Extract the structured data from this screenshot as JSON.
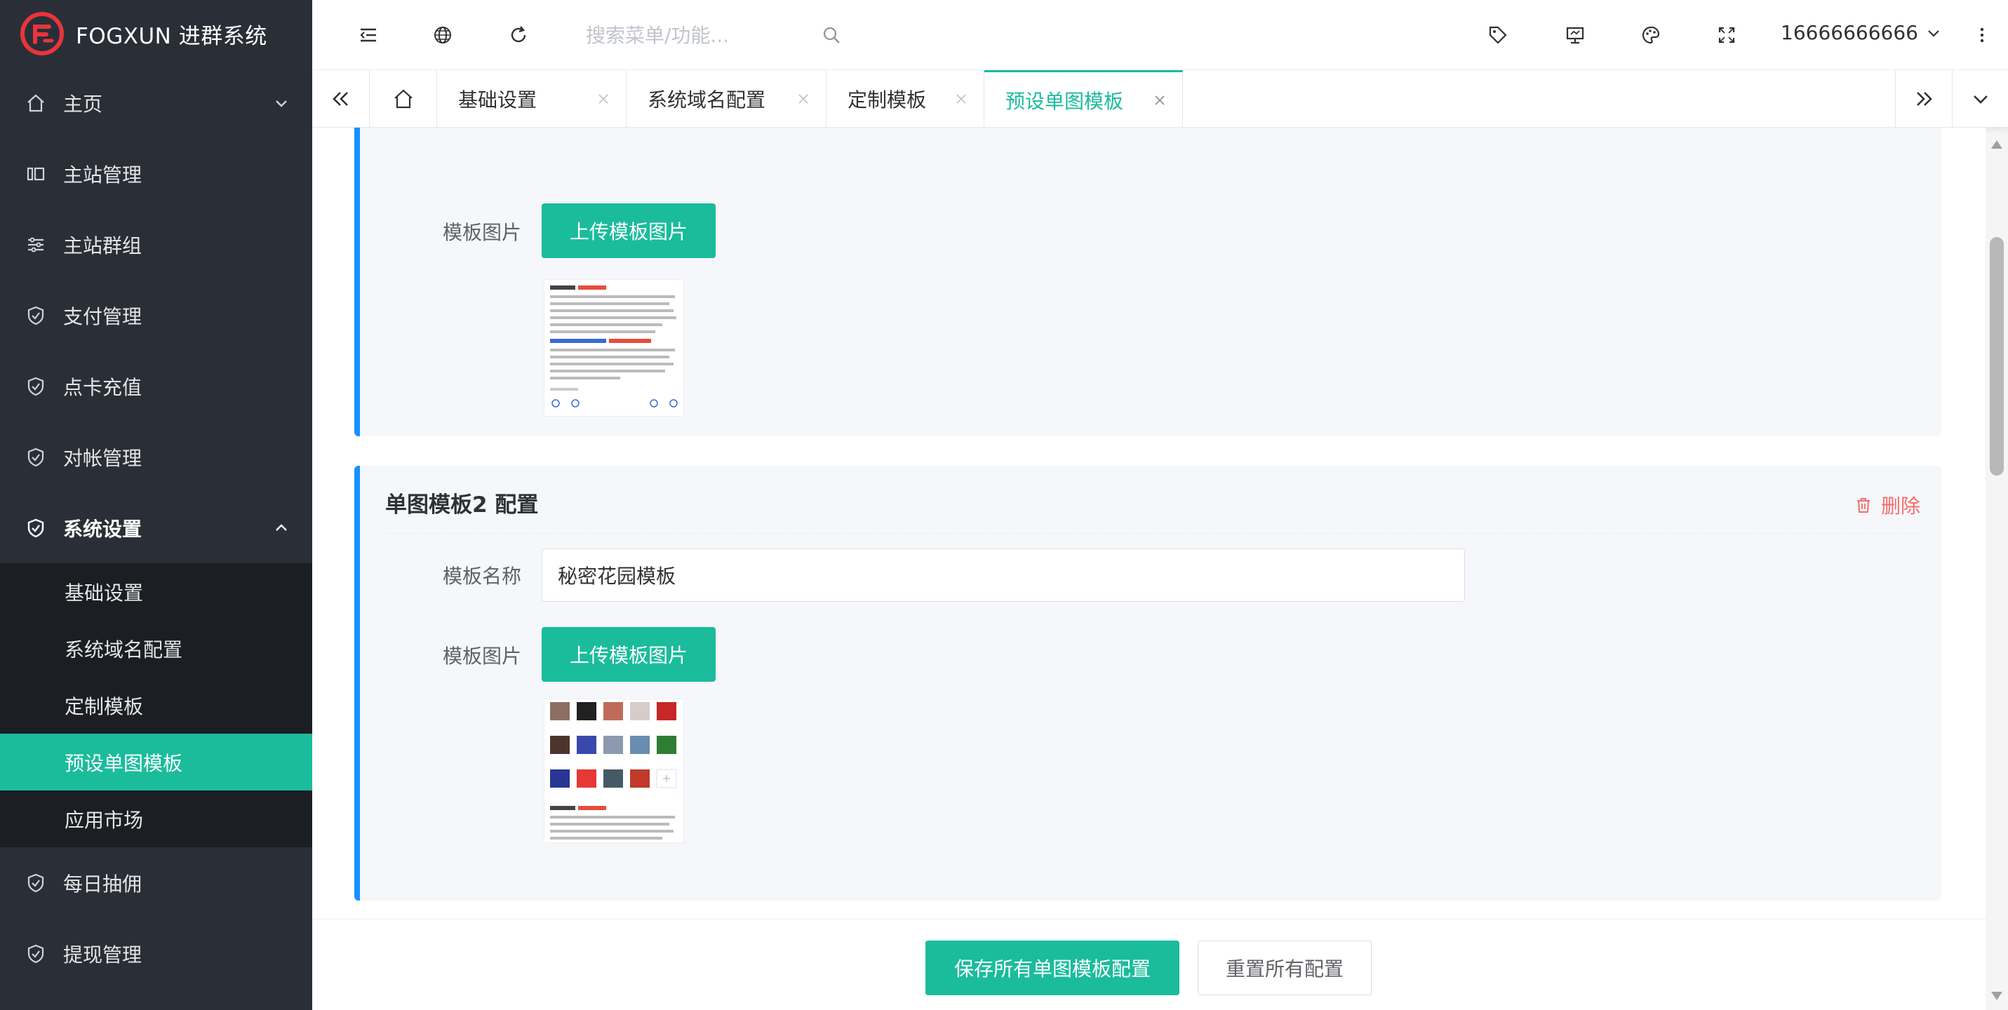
{
  "brand": {
    "name": "FOGXUN 进群系统",
    "accent": "#e8353b"
  },
  "colors": {
    "primary": "#1abc9c",
    "sidebar_bg": "#2a2f37",
    "submenu_bg": "#1b1e23",
    "card_border": "#1890ff",
    "danger": "#f56c6c"
  },
  "sidebar": {
    "items_top": [
      {
        "label": "主页",
        "icon": "home-icon",
        "arrow": "chevron-down-icon"
      },
      {
        "label": "主站管理",
        "icon": "columns-icon"
      },
      {
        "label": "主站群组",
        "icon": "sliders-icon"
      },
      {
        "label": "支付管理",
        "icon": "shield-check-icon"
      },
      {
        "label": "点卡充值",
        "icon": "shield-check-icon"
      },
      {
        "label": "对帐管理",
        "icon": "shield-check-icon"
      }
    ],
    "system_settings": {
      "label": "系统设置",
      "icon": "shield-check-icon",
      "arrow": "chevron-up-icon"
    },
    "submenu": [
      {
        "label": "基础设置"
      },
      {
        "label": "系统域名配置"
      },
      {
        "label": "定制模板"
      },
      {
        "label": "预设单图模板",
        "active": true
      },
      {
        "label": "应用市场"
      }
    ],
    "items_bottom": [
      {
        "label": "每日抽佣",
        "icon": "shield-check-icon"
      },
      {
        "label": "提现管理",
        "icon": "shield-check-icon"
      }
    ]
  },
  "header": {
    "search_placeholder": "搜索菜单/功能...",
    "user": "16666666666"
  },
  "tabs": [
    {
      "label": "基础设置"
    },
    {
      "label": "系统域名配置"
    },
    {
      "label": "定制模板"
    },
    {
      "label": "预设单图模板",
      "active": true
    }
  ],
  "cards": {
    "card1": {
      "image_label": "模板图片",
      "upload_label": "上传模板图片"
    },
    "card2": {
      "title": "单图模板2 配置",
      "delete_label": "删除",
      "name_label": "模板名称",
      "name_value": "秘密花园模板",
      "image_label": "模板图片",
      "upload_label": "上传模板图片"
    }
  },
  "footer": {
    "save_label": "保存所有单图模板配置",
    "reset_label": "重置所有配置"
  }
}
